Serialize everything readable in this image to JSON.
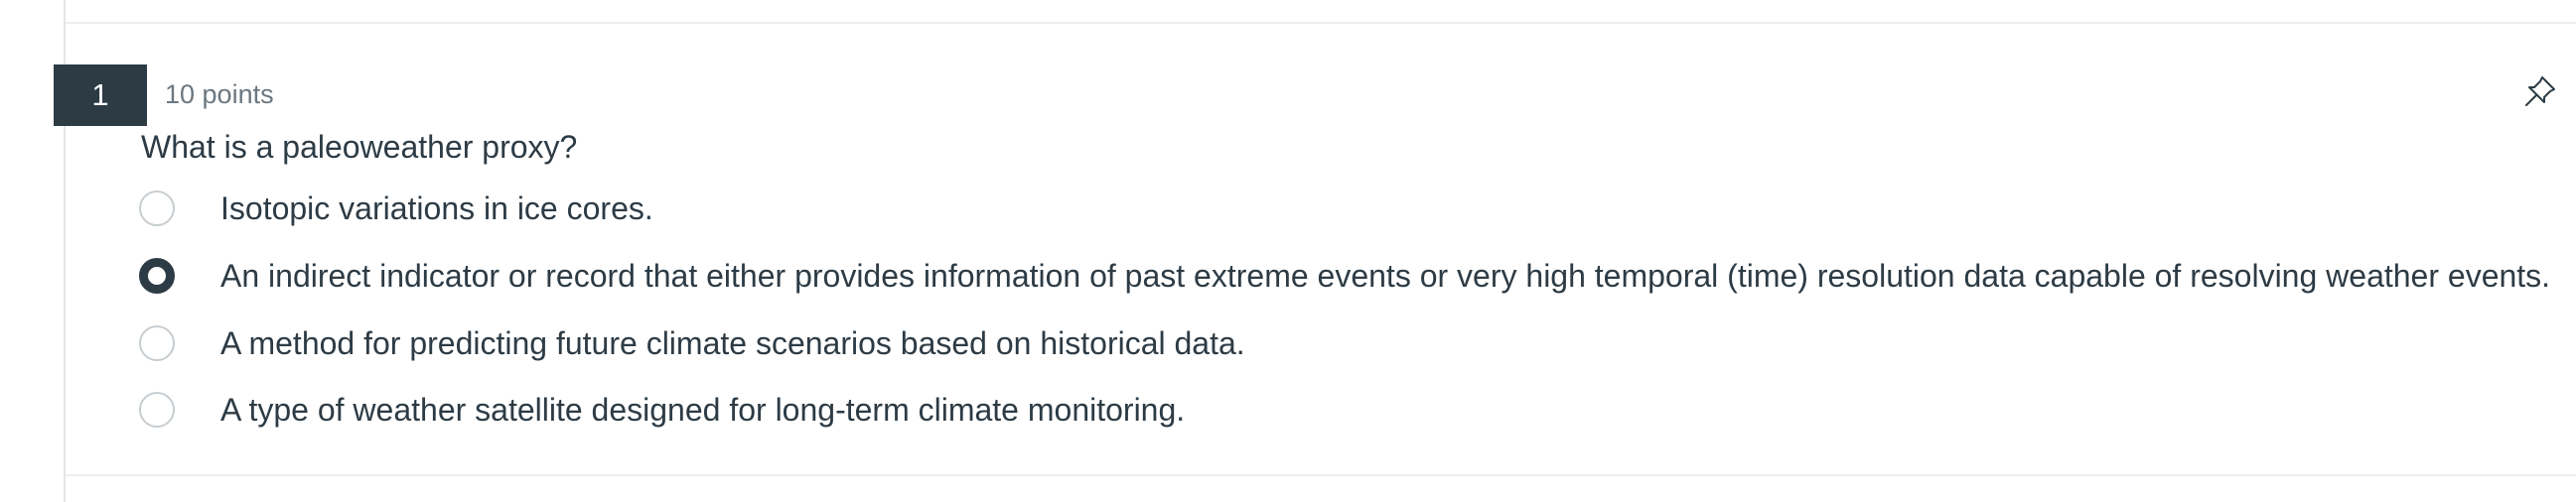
{
  "question": {
    "number": "1",
    "points": "10 points",
    "text": "What is a paleoweather proxy?"
  },
  "answers": [
    {
      "label": "Isotopic variations in ice cores.",
      "selected": false
    },
    {
      "label": "An indirect indicator or record that either provides information of past extreme events or very high temporal (time) resolution data capable of resolving weather events.",
      "selected": true
    },
    {
      "label": "A method for predicting future climate scenarios based on historical data.",
      "selected": false
    },
    {
      "label": "A type of weather satellite designed for long-term climate monitoring.",
      "selected": false
    }
  ],
  "icons": {
    "pin": "pin-icon"
  },
  "colors": {
    "badge": "#2d3b45",
    "text": "#2d3b45",
    "muted": "#6b7780",
    "radio_border": "#c7cdd1"
  }
}
